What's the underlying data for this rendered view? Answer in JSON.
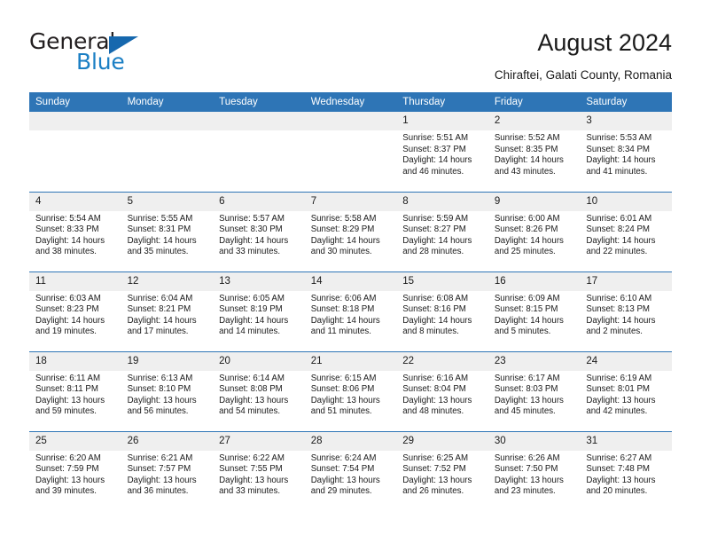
{
  "brand": {
    "name_part1": "General",
    "name_part2": "Blue",
    "triangle_icon": "blue-triangle-logo-mark",
    "colors": {
      "dark": "#231f20",
      "blue": "#1b7fc4",
      "triangle": "#1668ae"
    }
  },
  "header": {
    "title": "August 2024",
    "subtitle": "Chiraftei, Galati County, Romania"
  },
  "theme": {
    "header_blue": "#2e75b6",
    "daynum_band": "#efefef",
    "text": "#1a1a1a",
    "page_background": "#ffffff"
  },
  "calendar": {
    "weekday_headers": [
      "Sunday",
      "Monday",
      "Tuesday",
      "Wednesday",
      "Thursday",
      "Friday",
      "Saturday"
    ],
    "weeks": [
      [
        {
          "day": "",
          "sunrise": "",
          "sunset": "",
          "daylight": ""
        },
        {
          "day": "",
          "sunrise": "",
          "sunset": "",
          "daylight": ""
        },
        {
          "day": "",
          "sunrise": "",
          "sunset": "",
          "daylight": ""
        },
        {
          "day": "",
          "sunrise": "",
          "sunset": "",
          "daylight": ""
        },
        {
          "day": "1",
          "sunrise": "Sunrise: 5:51 AM",
          "sunset": "Sunset: 8:37 PM",
          "daylight": "Daylight: 14 hours and 46 minutes."
        },
        {
          "day": "2",
          "sunrise": "Sunrise: 5:52 AM",
          "sunset": "Sunset: 8:35 PM",
          "daylight": "Daylight: 14 hours and 43 minutes."
        },
        {
          "day": "3",
          "sunrise": "Sunrise: 5:53 AM",
          "sunset": "Sunset: 8:34 PM",
          "daylight": "Daylight: 14 hours and 41 minutes."
        }
      ],
      [
        {
          "day": "4",
          "sunrise": "Sunrise: 5:54 AM",
          "sunset": "Sunset: 8:33 PM",
          "daylight": "Daylight: 14 hours and 38 minutes."
        },
        {
          "day": "5",
          "sunrise": "Sunrise: 5:55 AM",
          "sunset": "Sunset: 8:31 PM",
          "daylight": "Daylight: 14 hours and 35 minutes."
        },
        {
          "day": "6",
          "sunrise": "Sunrise: 5:57 AM",
          "sunset": "Sunset: 8:30 PM",
          "daylight": "Daylight: 14 hours and 33 minutes."
        },
        {
          "day": "7",
          "sunrise": "Sunrise: 5:58 AM",
          "sunset": "Sunset: 8:29 PM",
          "daylight": "Daylight: 14 hours and 30 minutes."
        },
        {
          "day": "8",
          "sunrise": "Sunrise: 5:59 AM",
          "sunset": "Sunset: 8:27 PM",
          "daylight": "Daylight: 14 hours and 28 minutes."
        },
        {
          "day": "9",
          "sunrise": "Sunrise: 6:00 AM",
          "sunset": "Sunset: 8:26 PM",
          "daylight": "Daylight: 14 hours and 25 minutes."
        },
        {
          "day": "10",
          "sunrise": "Sunrise: 6:01 AM",
          "sunset": "Sunset: 8:24 PM",
          "daylight": "Daylight: 14 hours and 22 minutes."
        }
      ],
      [
        {
          "day": "11",
          "sunrise": "Sunrise: 6:03 AM",
          "sunset": "Sunset: 8:23 PM",
          "daylight": "Daylight: 14 hours and 19 minutes."
        },
        {
          "day": "12",
          "sunrise": "Sunrise: 6:04 AM",
          "sunset": "Sunset: 8:21 PM",
          "daylight": "Daylight: 14 hours and 17 minutes."
        },
        {
          "day": "13",
          "sunrise": "Sunrise: 6:05 AM",
          "sunset": "Sunset: 8:19 PM",
          "daylight": "Daylight: 14 hours and 14 minutes."
        },
        {
          "day": "14",
          "sunrise": "Sunrise: 6:06 AM",
          "sunset": "Sunset: 8:18 PM",
          "daylight": "Daylight: 14 hours and 11 minutes."
        },
        {
          "day": "15",
          "sunrise": "Sunrise: 6:08 AM",
          "sunset": "Sunset: 8:16 PM",
          "daylight": "Daylight: 14 hours and 8 minutes."
        },
        {
          "day": "16",
          "sunrise": "Sunrise: 6:09 AM",
          "sunset": "Sunset: 8:15 PM",
          "daylight": "Daylight: 14 hours and 5 minutes."
        },
        {
          "day": "17",
          "sunrise": "Sunrise: 6:10 AM",
          "sunset": "Sunset: 8:13 PM",
          "daylight": "Daylight: 14 hours and 2 minutes."
        }
      ],
      [
        {
          "day": "18",
          "sunrise": "Sunrise: 6:11 AM",
          "sunset": "Sunset: 8:11 PM",
          "daylight": "Daylight: 13 hours and 59 minutes."
        },
        {
          "day": "19",
          "sunrise": "Sunrise: 6:13 AM",
          "sunset": "Sunset: 8:10 PM",
          "daylight": "Daylight: 13 hours and 56 minutes."
        },
        {
          "day": "20",
          "sunrise": "Sunrise: 6:14 AM",
          "sunset": "Sunset: 8:08 PM",
          "daylight": "Daylight: 13 hours and 54 minutes."
        },
        {
          "day": "21",
          "sunrise": "Sunrise: 6:15 AM",
          "sunset": "Sunset: 8:06 PM",
          "daylight": "Daylight: 13 hours and 51 minutes."
        },
        {
          "day": "22",
          "sunrise": "Sunrise: 6:16 AM",
          "sunset": "Sunset: 8:04 PM",
          "daylight": "Daylight: 13 hours and 48 minutes."
        },
        {
          "day": "23",
          "sunrise": "Sunrise: 6:17 AM",
          "sunset": "Sunset: 8:03 PM",
          "daylight": "Daylight: 13 hours and 45 minutes."
        },
        {
          "day": "24",
          "sunrise": "Sunrise: 6:19 AM",
          "sunset": "Sunset: 8:01 PM",
          "daylight": "Daylight: 13 hours and 42 minutes."
        }
      ],
      [
        {
          "day": "25",
          "sunrise": "Sunrise: 6:20 AM",
          "sunset": "Sunset: 7:59 PM",
          "daylight": "Daylight: 13 hours and 39 minutes."
        },
        {
          "day": "26",
          "sunrise": "Sunrise: 6:21 AM",
          "sunset": "Sunset: 7:57 PM",
          "daylight": "Daylight: 13 hours and 36 minutes."
        },
        {
          "day": "27",
          "sunrise": "Sunrise: 6:22 AM",
          "sunset": "Sunset: 7:55 PM",
          "daylight": "Daylight: 13 hours and 33 minutes."
        },
        {
          "day": "28",
          "sunrise": "Sunrise: 6:24 AM",
          "sunset": "Sunset: 7:54 PM",
          "daylight": "Daylight: 13 hours and 29 minutes."
        },
        {
          "day": "29",
          "sunrise": "Sunrise: 6:25 AM",
          "sunset": "Sunset: 7:52 PM",
          "daylight": "Daylight: 13 hours and 26 minutes."
        },
        {
          "day": "30",
          "sunrise": "Sunrise: 6:26 AM",
          "sunset": "Sunset: 7:50 PM",
          "daylight": "Daylight: 13 hours and 23 minutes."
        },
        {
          "day": "31",
          "sunrise": "Sunrise: 6:27 AM",
          "sunset": "Sunset: 7:48 PM",
          "daylight": "Daylight: 13 hours and 20 minutes."
        }
      ]
    ]
  }
}
